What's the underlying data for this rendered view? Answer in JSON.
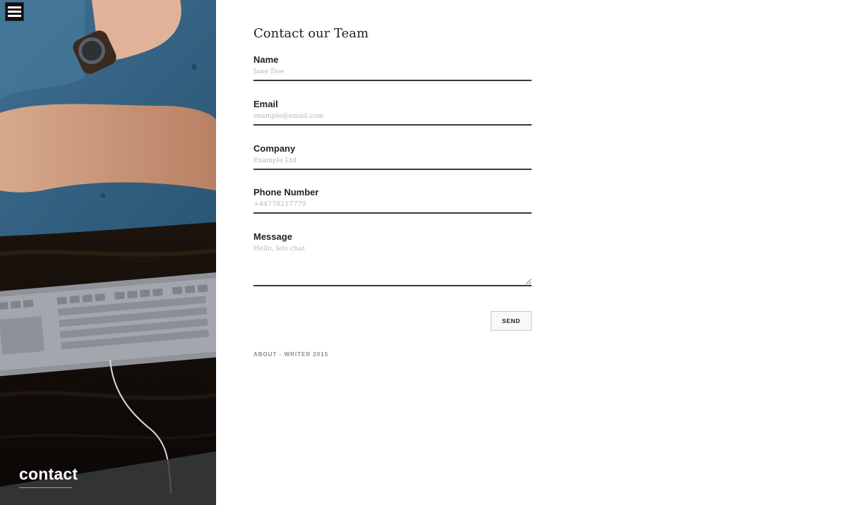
{
  "hero": {
    "title": "contact",
    "menu_icon": "hamburger-menu-icon"
  },
  "form": {
    "title": "Contact our Team",
    "fields": [
      {
        "label": "Name",
        "placeholder": "Jane Doe"
      },
      {
        "label": "Email",
        "placeholder": "example@email.com"
      },
      {
        "label": "Company",
        "placeholder": "Example Ltd"
      },
      {
        "label": "Phone Number",
        "placeholder": "+44778217779"
      },
      {
        "label": "Message",
        "placeholder": "Hello, lets chat"
      }
    ],
    "send_label": "SEND"
  },
  "footer": {
    "about": "ABOUT",
    "separator": "·",
    "credit": "WRITER 2015"
  },
  "colors": {
    "text": "#222222",
    "muted": "#8a8a8a",
    "input_border": "#3a3a3a"
  }
}
